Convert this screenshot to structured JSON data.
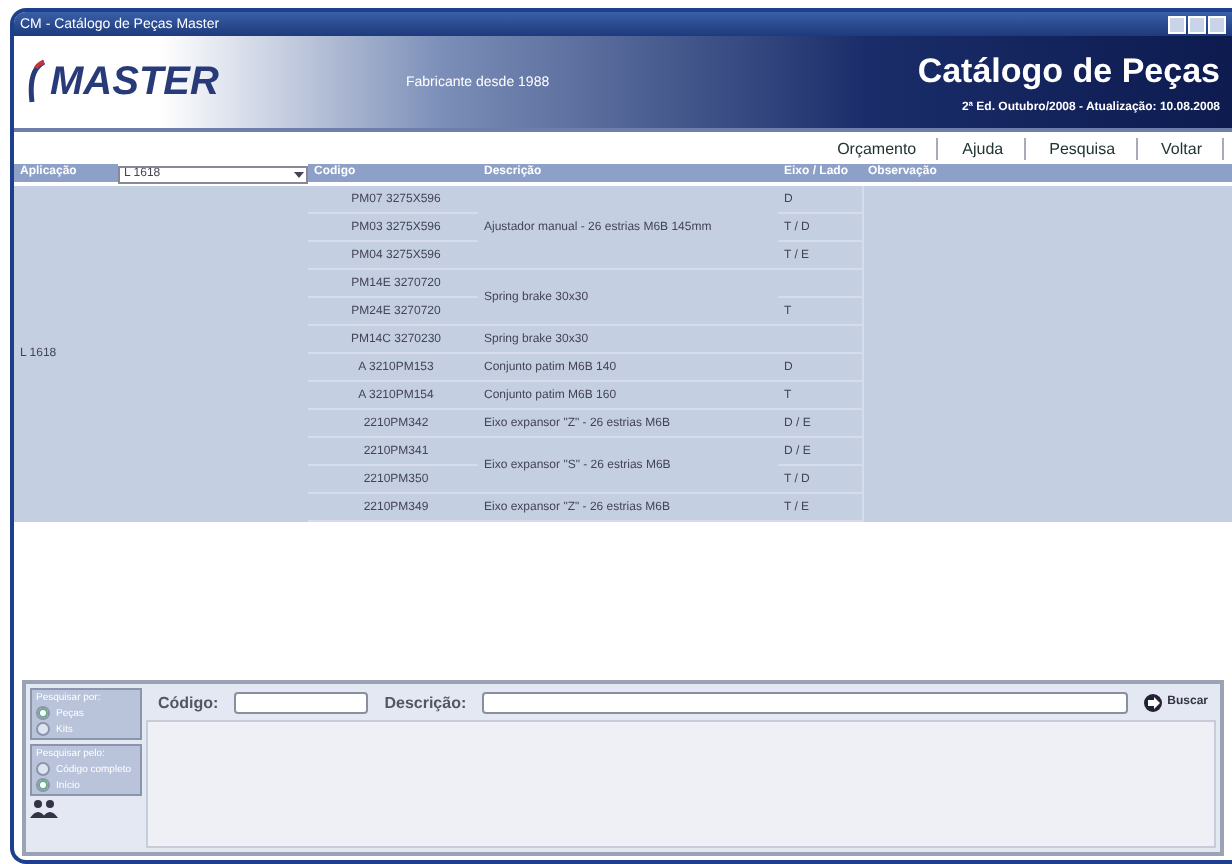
{
  "window": {
    "title": "CM - Catálogo de Peças Master"
  },
  "header": {
    "logo": "MASTER",
    "tagline": "Fabricante desde 1988",
    "title": "Catálogo de Peças",
    "edition": "2ª Ed. Outubro/2008 - Atualização: 10.08.2008"
  },
  "nav": [
    "Orçamento",
    "Ajuda",
    "Pesquisa",
    "Voltar"
  ],
  "table": {
    "application_label": "Aplicação",
    "application_value": "L 1618",
    "columns": [
      "Codigo",
      "Descrição",
      "Eixo / Lado",
      "Observação"
    ],
    "application": "L 1618",
    "groups": [
      {
        "description": "Ajustador manual - 26 estrias M6B 145mm",
        "items": [
          {
            "code": "PM07 3275X596",
            "axle": "D"
          },
          {
            "code": "PM03 3275X596",
            "axle": "T / D"
          },
          {
            "code": "PM04 3275X596",
            "axle": "T / E"
          }
        ]
      },
      {
        "description": "Spring brake 30x30",
        "items": [
          {
            "code": "PM14E 3270720"
          },
          {
            "code": "PM24E 3270720",
            "axle": "T"
          }
        ]
      },
      {
        "description": "Spring brake 30x30",
        "items": [
          {
            "code": "PM14C 3270230"
          }
        ]
      },
      {
        "description": "Conjunto patim M6B 140",
        "items": [
          {
            "code": "A 3210PM153",
            "axle": "D"
          }
        ]
      },
      {
        "description": "Conjunto patim M6B 160",
        "items": [
          {
            "code": "A 3210PM154",
            "axle": "T"
          }
        ]
      },
      {
        "description": "Eixo expansor \"Z\" - 26 estrias M6B",
        "items": [
          {
            "code": "2210PM342",
            "axle": "D / E"
          }
        ]
      },
      {
        "description": "Eixo expansor \"S\" - 26 estrias M6B",
        "items": [
          {
            "code": "2210PM341",
            "axle": "D / E"
          },
          {
            "code": "2210PM350",
            "axle": "T / D"
          }
        ]
      },
      {
        "description": "Eixo expansor \"Z\" - 26 estrias M6B",
        "items": [
          {
            "code": "2210PM349",
            "axle": "T / E"
          }
        ]
      }
    ]
  },
  "search": {
    "groups": [
      {
        "title": "Pesquisar por:",
        "options": [
          {
            "label": "Peças",
            "selected": true
          },
          {
            "label": "Kits",
            "selected": false
          }
        ]
      },
      {
        "title": "Pesquisar pelo:",
        "options": [
          {
            "label": "Código completo",
            "selected": false
          },
          {
            "label": "Início",
            "selected": true
          }
        ]
      }
    ],
    "code_label": "Código:",
    "description_label": "Descrição:",
    "button": "Buscar"
  }
}
